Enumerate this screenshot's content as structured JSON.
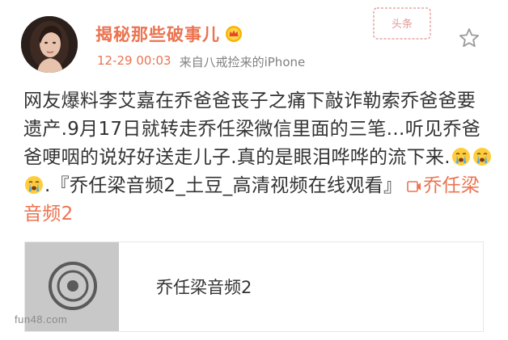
{
  "post": {
    "username": "揭秘那些破事儿",
    "time": "12-29 00:03",
    "source": "来自八戒捡来的iPhone",
    "stamp_text": "头条",
    "content_parts": {
      "text_main": "网友爆料李艾嘉在乔爸爸丧子之痛下敲诈勒索乔爸爸要遗产.9月17日就转走乔任梁微信里面的三笔…听见乔爸爸哽咽的说好好送走儿子.真的是眼泪哗哗的流下来.",
      "text_after_emoji": ".『乔任梁音频2_土豆_高清视频在线观看』",
      "link_text": "乔任梁音频2"
    },
    "emojis": [
      "crying-face",
      "crying-face",
      "crying-face"
    ],
    "card": {
      "title": "乔任梁音频2"
    },
    "watermark": "fun48.com"
  },
  "colors": {
    "accent": "#eb7350",
    "text": "#333333",
    "meta": "#808080",
    "card_thumb": "#c8c8c8"
  },
  "icons": {
    "favorite": "star-outline-icon",
    "vip": "crown-badge-icon",
    "link": "video-link-icon",
    "disc": "music-disc-icon"
  }
}
